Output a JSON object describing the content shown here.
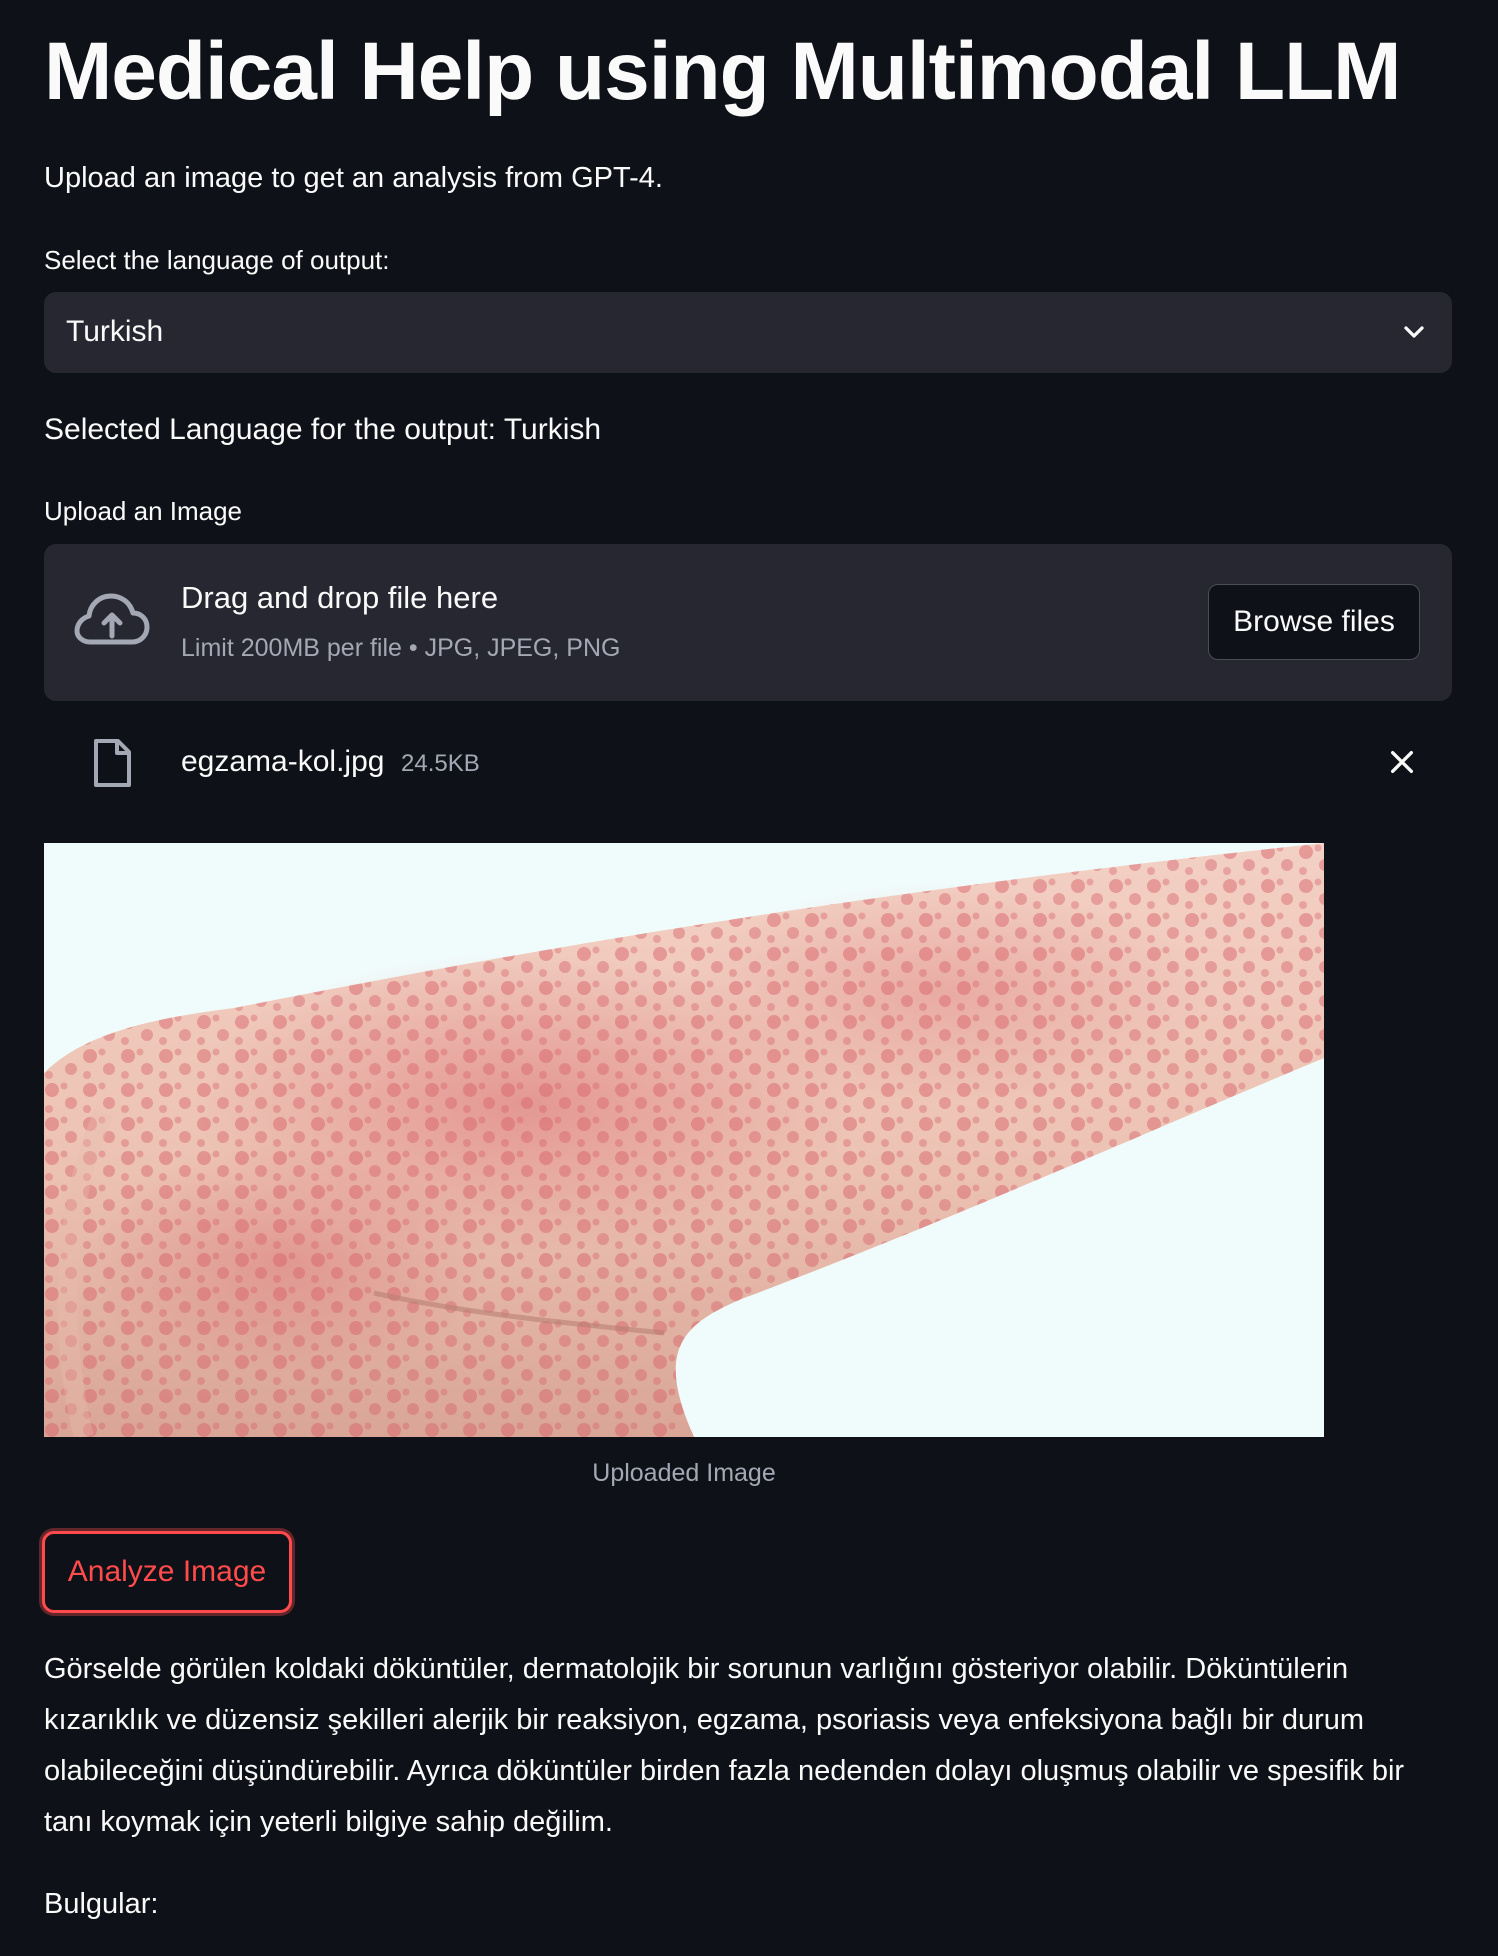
{
  "page": {
    "title": "Medical Help using Multimodal LLM",
    "subtitle": "Upload an image to get an analysis from GPT-4."
  },
  "language_select": {
    "label": "Select the language of output:",
    "value": "Turkish",
    "icon": "chevron-down-icon"
  },
  "selected_language_text": "Selected Language for the output: Turkish",
  "uploader": {
    "label": "Upload an Image",
    "drag_title": "Drag and drop file here",
    "limit_text": "Limit 200MB per file • JPG, JPEG, PNG",
    "browse_label": "Browse files",
    "icon": "cloud-upload-icon"
  },
  "uploaded_file": {
    "name": "egzama-kol.jpg",
    "size": "24.5KB",
    "icon": "file-icon",
    "remove_icon": "close-icon"
  },
  "image": {
    "caption": "Uploaded Image"
  },
  "analyze_button": {
    "label": "Analyze Image",
    "color": "#ff4b4b"
  },
  "result": {
    "text": "Görselde görülen koldaki döküntüler, dermatolojik bir sorunun varlığını gösteriyor olabilir. Döküntülerin kızarıklık ve düzensiz şekilleri alerjik bir reaksiyon, egzama, psoriasis veya enfeksiyona bağlı bir durum olabileceğini düşündürebilir. Ayrıca döküntüler birden fazla nedenden dolayı oluşmuş olabilir ve spesifik bir tanı koymak için yeterli bilgiye sahip değilim.",
    "findings_label": "Bulgular:"
  },
  "colors": {
    "background": "#0e1117",
    "surface": "#262730",
    "text": "#fafafa",
    "muted": "#a3a8b4",
    "accent": "#ff4b4b"
  }
}
